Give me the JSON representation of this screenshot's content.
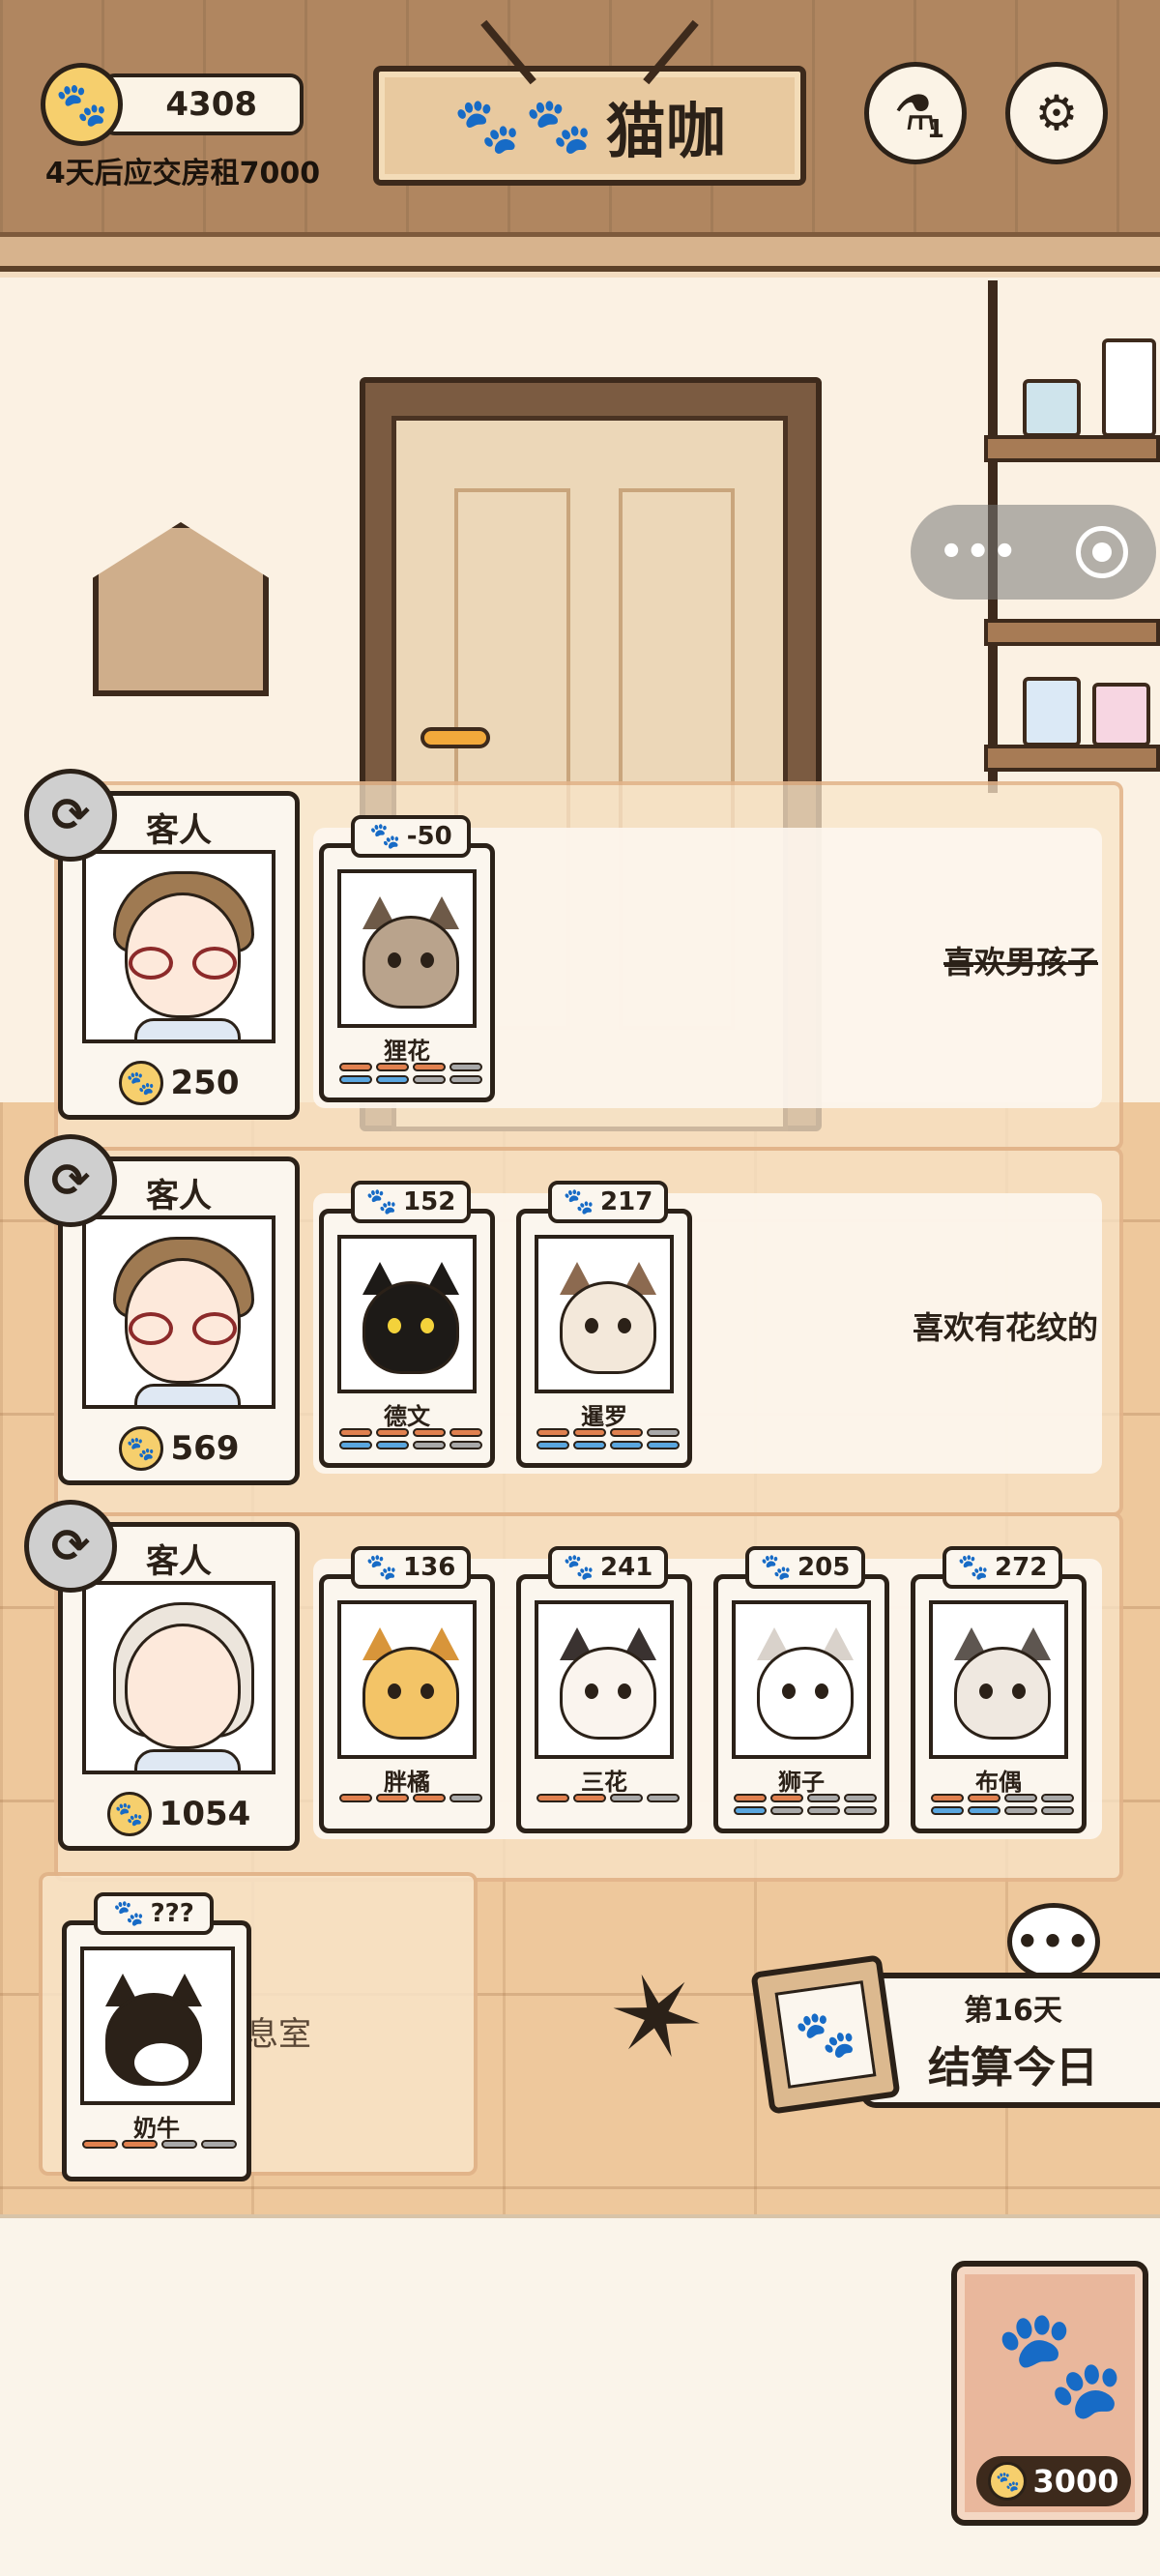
{
  "header": {
    "coins": "4308",
    "rent_note": "4天后应交房租7000",
    "title_paws": "🐾🐾",
    "title": "猫咖",
    "potion_count": "1"
  },
  "icons": {
    "coin": "paw-icon",
    "potion": "potion-icon",
    "settings": "gear-icon",
    "refresh": "refresh-icon"
  },
  "guest_label": "客人",
  "customers": [
    {
      "coins": "250",
      "hair": "brown",
      "preference": "喜欢男孩子",
      "preference_struck": true,
      "cats": [
        {
          "score": "-50",
          "name": "狸花",
          "orange": 3,
          "blue": 2
        }
      ]
    },
    {
      "coins": "569",
      "hair": "brown",
      "preference": "喜欢有花纹的",
      "preference_struck": false,
      "cats": [
        {
          "score": "152",
          "name": "德文",
          "orange": 4,
          "blue": 2
        },
        {
          "score": "217",
          "name": "暹罗",
          "orange": 3,
          "blue": 4
        }
      ]
    },
    {
      "coins": "1054",
      "hair": "white",
      "preference": "",
      "preference_struck": false,
      "cats": [
        {
          "score": "136",
          "name": "胖橘",
          "orange": 3,
          "blue": 0
        },
        {
          "score": "241",
          "name": "三花",
          "orange": 2,
          "blue": 0
        },
        {
          "score": "205",
          "name": "狮子",
          "orange": 2,
          "blue": 1
        },
        {
          "score": "272",
          "name": "布偶",
          "orange": 2,
          "blue": 2
        }
      ]
    }
  ],
  "lounge": {
    "label_partial": "息室",
    "cat": {
      "score": "???",
      "name": "奶牛",
      "orange": 2,
      "blue": 0
    }
  },
  "settle": {
    "day": "第16天",
    "label": "结算今日",
    "bubble": "•••"
  },
  "shop": {
    "price": "3000"
  },
  "capsule": {
    "dots": "•••"
  },
  "colors": {
    "stat_orange": "#e1814f",
    "stat_blue": "#5aa6df",
    "stat_empty": "#a9a9a9",
    "coin_gold": "#f6cf6d"
  }
}
